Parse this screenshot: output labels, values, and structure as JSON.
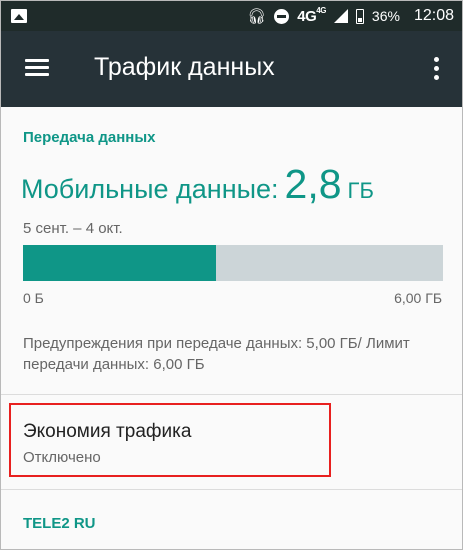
{
  "status_bar": {
    "network": "4G",
    "network_sup": "4G",
    "battery": "36%",
    "time": "12:08"
  },
  "toolbar": {
    "title": "Трафик данных"
  },
  "data_section": {
    "header": "Передача данных",
    "usage_label": "Мобильные данные:",
    "usage_value": "2,8",
    "usage_unit": "ГБ",
    "period": "5 сент. – 4 окт.",
    "bar_min_label": "0 Б",
    "bar_max_label": "6,00 ГБ",
    "usage_fraction": 0.46,
    "warning_text": "Предупреждения при передаче данных: 5,00 ГБ/ Лимит передачи данных: 6,00 ГБ"
  },
  "data_saver": {
    "title": "Экономия трафика",
    "status": "Отключено"
  },
  "carrier": {
    "name": "TELE2 RU"
  },
  "colors": {
    "accent": "#0f9687",
    "toolbar": "#263238",
    "status_bar": "#1f2b2a",
    "highlight": "#e8201f"
  }
}
